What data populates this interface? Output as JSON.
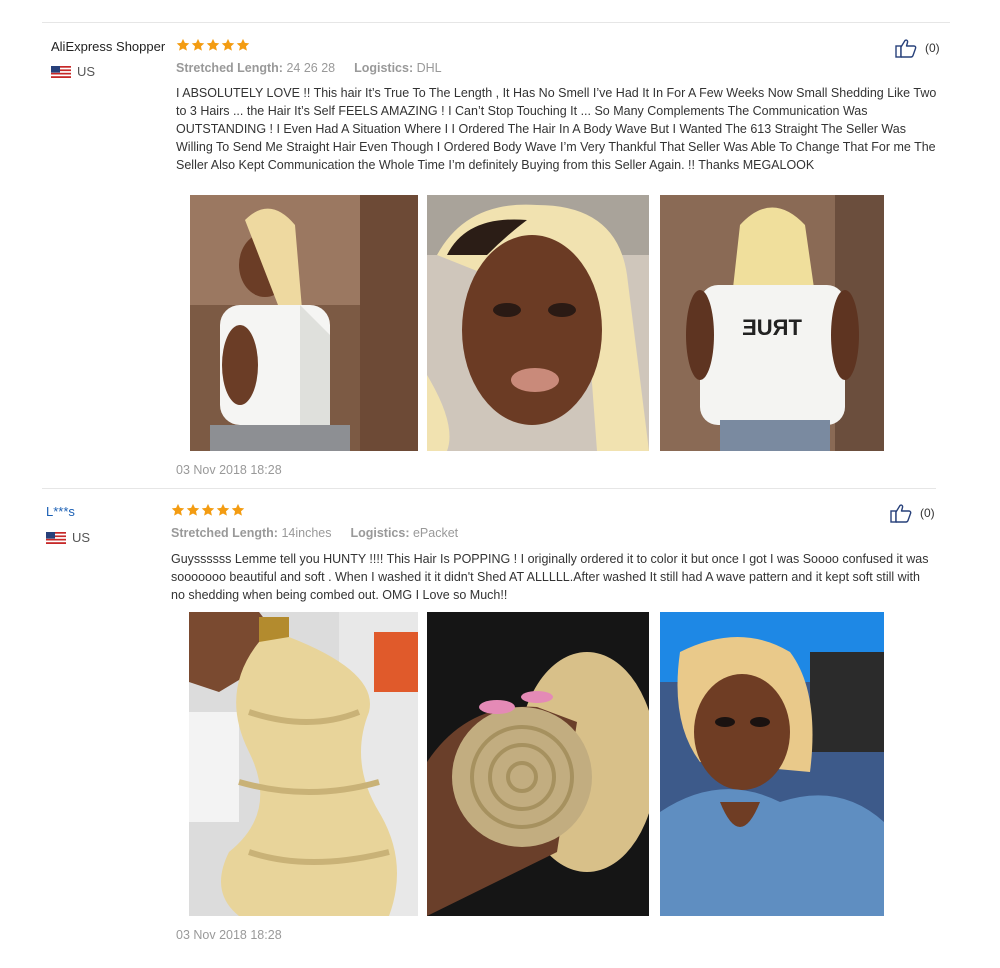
{
  "reviews": [
    {
      "name": "AliExpress Shopper",
      "country": "US",
      "rating": 5,
      "attr1_label": "Stretched Length:",
      "attr1_value": "24 26 28",
      "attr2_label": "Logistics:",
      "attr2_value": "DHL",
      "text": "I ABSOLUTELY LOVE !! This hair It’s True To The Length , It Has No Smell I’ve Had It In For A Few Weeks Now Small Shedding Like Two to 3 Hairs ... the Hair It’s Self FEELS AMAZING ! I Can’t Stop Touching It ... So Many Complements The Communication Was OUTSTANDING ! I Even Had A Situation Where I I Ordered The Hair In A Body Wave But I Wanted The 613 Straight The Seller Was Willing To Send Me Straight Hair Even Though I Ordered Body Wave I’m Very Thankful That Seller Was Able To Change That For me The Seller Also Kept Communication the Whole Time I’m definitely Buying from this Seller Again. !! Thanks MEGALOOK",
      "likes": "(0)",
      "date": "03 Nov 2018 18:28"
    },
    {
      "name": "L***s",
      "country": "US",
      "rating": 5,
      "attr1_label": "Stretched Length:",
      "attr1_value": "14inches",
      "attr2_label": "Logistics:",
      "attr2_value": "ePacket",
      "text": "Guyssssss Lemme tell you HUNTY !!!! This Hair Is POPPING ! I originally ordered it to color it but once I got I was Soooo confused it was sooooooo beautiful and soft . When I washed it it didn't Shed AT ALLLLL.After washed It still had A wave pattern and it kept soft still with no shedding when being combed out. OMG I Love so Much!!",
      "likes": "(0)",
      "date": "03 Nov 2018 18:28"
    }
  ],
  "colors": {
    "star": "#f39c12",
    "link": "#1a5fb4",
    "muted": "#999999",
    "hair_blonde": "#e8d49a",
    "skin": "#7a4a30"
  },
  "icons": {
    "star": "star-icon",
    "like": "thumbs-up-icon",
    "flag": "us-flag-icon"
  }
}
